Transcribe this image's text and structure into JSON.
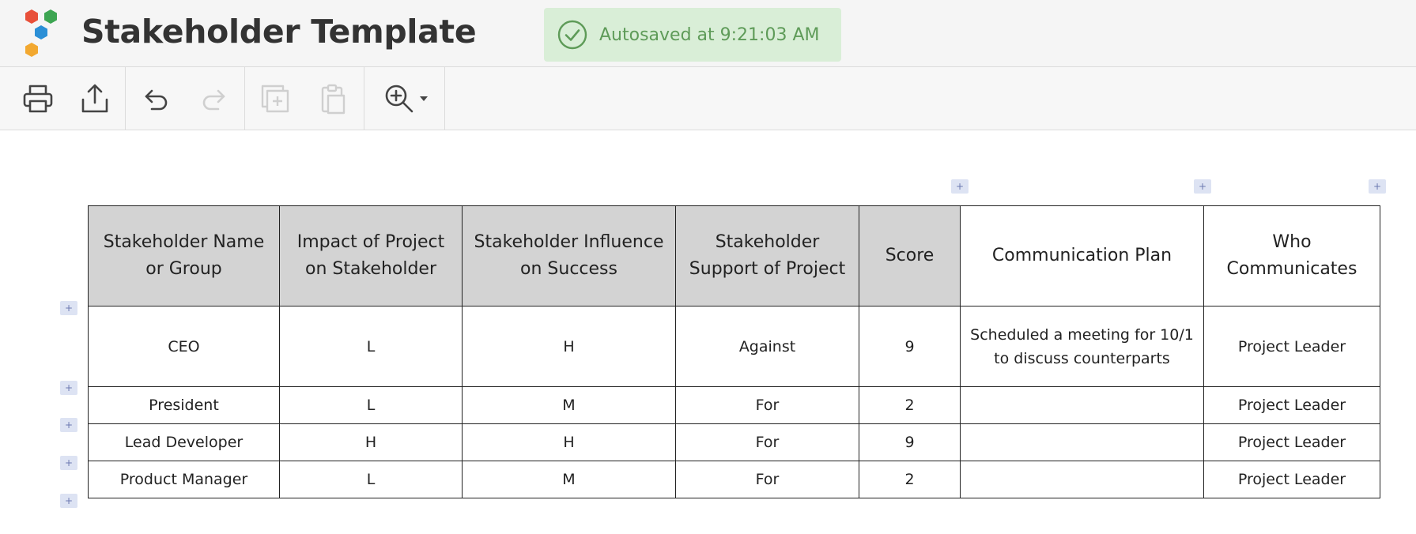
{
  "app": {
    "title": "Stakeholder Template",
    "autosave_text": "Autosaved at 9:21:03 AM"
  },
  "toolbar": {
    "buttons": [
      {
        "name": "print-icon",
        "enabled": true
      },
      {
        "name": "export-icon",
        "enabled": true
      },
      {
        "name": "undo-icon",
        "enabled": true
      },
      {
        "name": "redo-icon",
        "enabled": false
      },
      {
        "name": "duplicate-icon",
        "enabled": false
      },
      {
        "name": "paste-icon",
        "enabled": false
      },
      {
        "name": "zoom-icon",
        "enabled": true
      }
    ]
  },
  "table": {
    "headers": [
      "Stakeholder Name or Group",
      "Impact of Project on Stakeholder",
      "Stakeholder Influence on Success",
      "Stakeholder Support of Project",
      "Score",
      "Communication Plan",
      "Who Communicates"
    ],
    "rows": [
      [
        "CEO",
        "L",
        "H",
        "Against",
        "9",
        "Scheduled a meeting for 10/1 to discuss counterparts",
        "Project Leader"
      ],
      [
        "President",
        "L",
        "M",
        "For",
        "2",
        "",
        "Project Leader"
      ],
      [
        "Lead Developer",
        "H",
        "H",
        "For",
        "9",
        "",
        "Project Leader"
      ],
      [
        "Product Manager",
        "L",
        "M",
        "For",
        "2",
        "",
        "Project Leader"
      ]
    ],
    "add_glyph": "+"
  },
  "colors": {
    "header_shade": "#d3d3d3",
    "autosave_bg": "#d9eed7",
    "autosave_text": "#5e9b58",
    "level_text": "#5a1a6a"
  }
}
